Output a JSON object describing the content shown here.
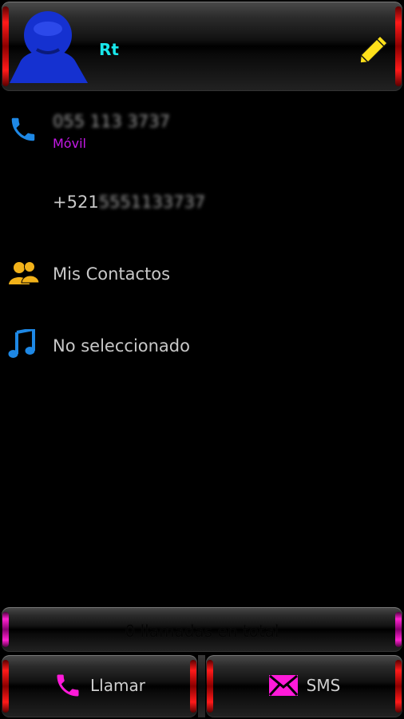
{
  "header": {
    "contact_name": "Rt"
  },
  "phone": {
    "number": "055 113 3737",
    "type": "Móvil",
    "alt_prefix": "+521",
    "alt_rest": "5551133737"
  },
  "group": {
    "label": "Mis Contactos"
  },
  "ringtone": {
    "label": "No seleccionado"
  },
  "call_count": {
    "label": "0 llamadas en total"
  },
  "actions": {
    "call_label": "Llamar",
    "sms_label": "SMS"
  },
  "colors": {
    "name": "#19e6ea",
    "phone_type": "#c419e6",
    "phone_icon": "#1e88e5",
    "action_icons": "#ff1ad9",
    "edit_icon": "#ffe01a",
    "group_icon": "#f2b21a",
    "avatar": "#1531d0"
  },
  "icons": {
    "avatar": "person-icon",
    "edit": "pencil-icon",
    "phone": "phone-icon",
    "group": "people-icon",
    "ringtone": "music-note-icon",
    "sms": "envelope-icon"
  }
}
